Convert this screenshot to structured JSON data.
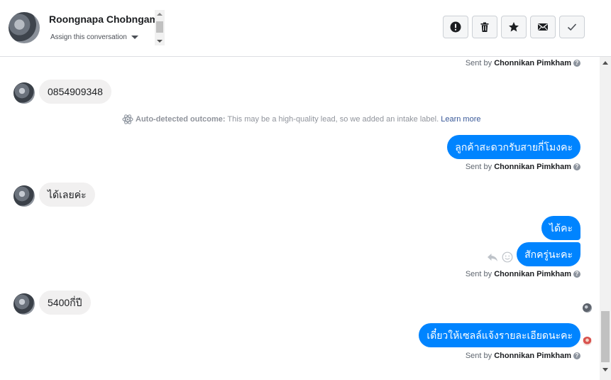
{
  "header": {
    "contact_name": "Roongnapa Chobngam",
    "assign_label": "Assign this conversation"
  },
  "actions": [
    {
      "name": "mark-spam-button",
      "icon": "exclamation-icon"
    },
    {
      "name": "delete-button",
      "icon": "trash-icon"
    },
    {
      "name": "star-button",
      "icon": "star-icon"
    },
    {
      "name": "mark-unread-button",
      "icon": "envelope-icon"
    },
    {
      "name": "mark-done-button",
      "icon": "checkmark-icon"
    }
  ],
  "sent_by": {
    "prefix": "Sent by",
    "agent": "Chonnikan Pimkham",
    "help": "?"
  },
  "outcome": {
    "label": "Auto-detected outcome:",
    "text": "This may be a high-quality lead, so we added an intake label.",
    "link": "Learn more"
  },
  "messages": {
    "in1": "0854909348",
    "out1": "ลูกค้าสะดวกรับสายกี่โมงคะ",
    "in2": "ได้เลยค่ะ",
    "out2": "ได้คะ",
    "out3": "สักครู่นะคะ",
    "in3": "5400กี่ปี",
    "out4": "เดี๋ยวให้เซลล์แจ้งรายละเอียดนะคะ"
  },
  "colors": {
    "outgoing_bubble": "#0084ff",
    "incoming_bubble": "#f1f0f0",
    "link": "#385898"
  }
}
